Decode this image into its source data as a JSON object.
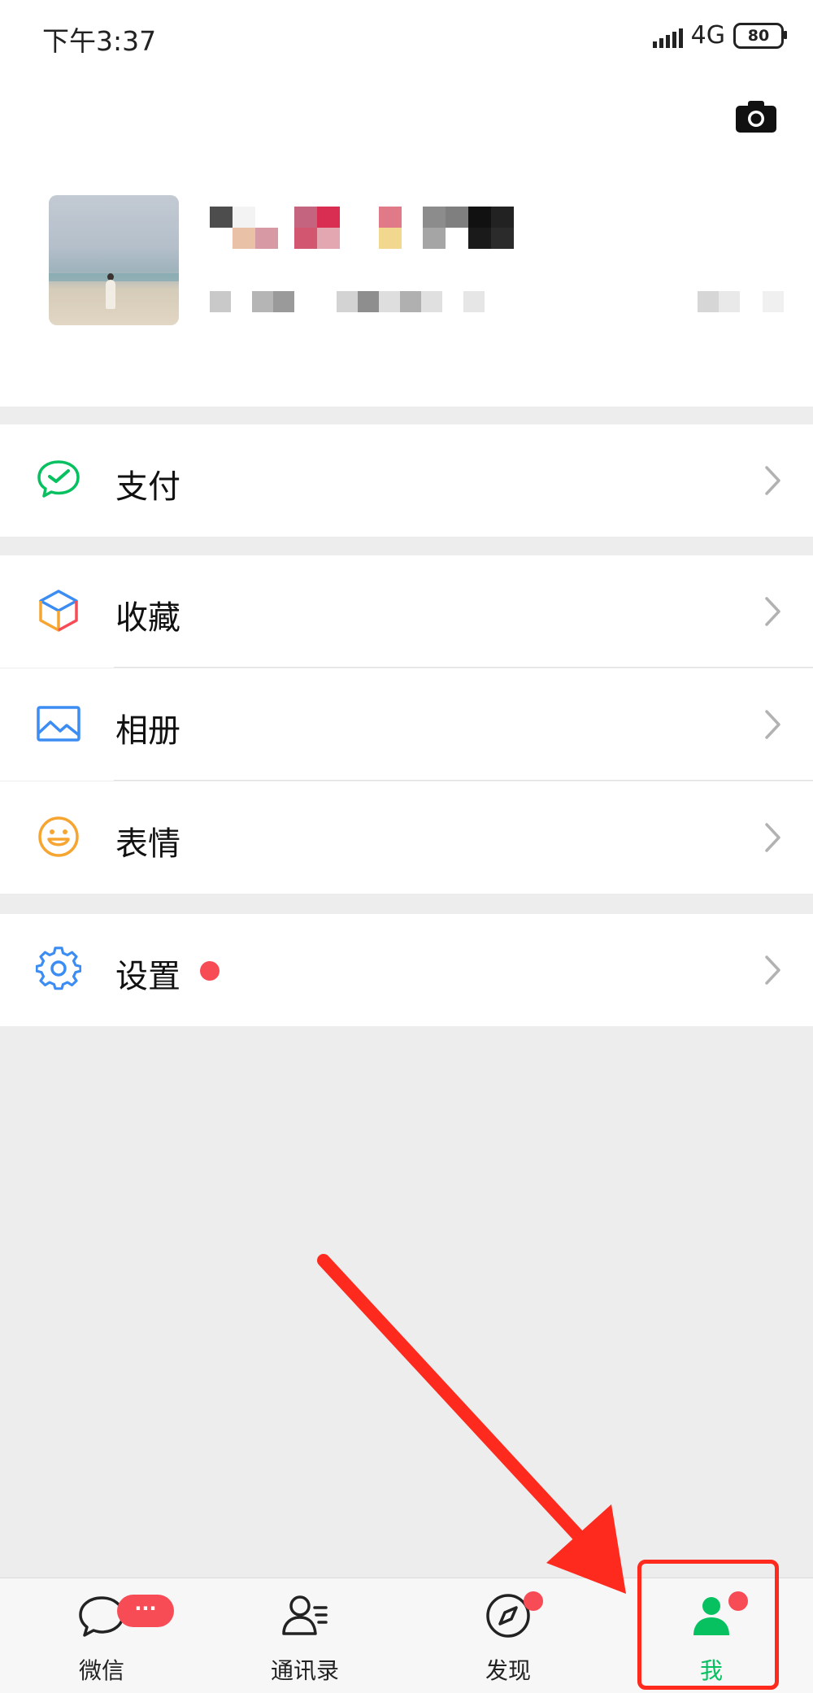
{
  "status_bar": {
    "time": "下午3:37",
    "network": "4G",
    "battery": "80"
  },
  "profile": {
    "camera_icon": "camera-icon",
    "avatar_description_icon": "avatar-photo"
  },
  "menu": {
    "pay": {
      "label": "支付",
      "icon": "wechat-pay-icon"
    },
    "favorites": {
      "label": "收藏",
      "icon": "cube-icon"
    },
    "album": {
      "label": "相册",
      "icon": "image-icon"
    },
    "stickers": {
      "label": "表情",
      "icon": "smile-icon"
    },
    "settings": {
      "label": "设置",
      "icon": "gear-icon",
      "has_red_dot": true
    }
  },
  "tabs": [
    {
      "label": "微信",
      "icon": "chat-bubble-icon",
      "badge": "···"
    },
    {
      "label": "通讯录",
      "icon": "contacts-icon"
    },
    {
      "label": "发现",
      "icon": "compass-icon",
      "has_red_dot": true
    },
    {
      "label": "我",
      "icon": "person-icon",
      "active": true,
      "has_red_dot": true
    }
  ],
  "colors": {
    "accent_green": "#07c160",
    "red_dot": "#f74b56",
    "annotation_red": "#ff2a1e",
    "background": "#ededed"
  }
}
